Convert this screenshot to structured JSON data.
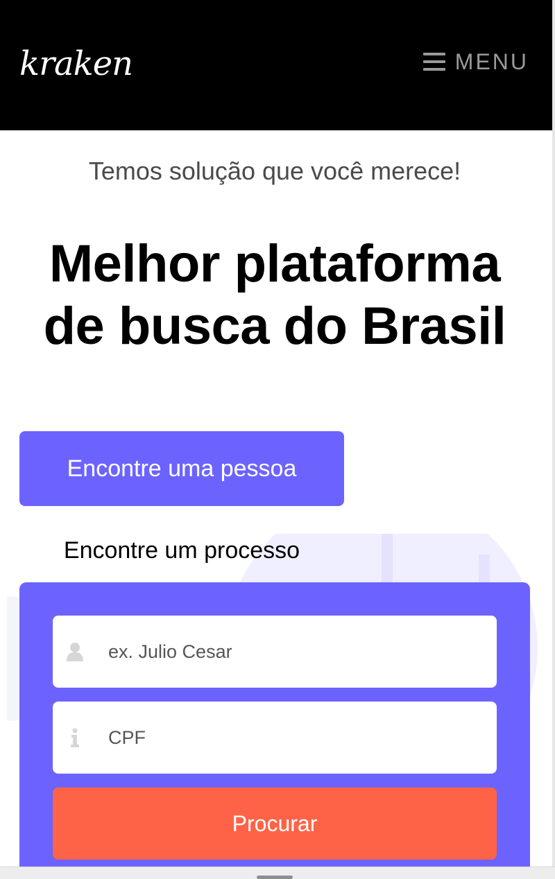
{
  "header": {
    "logo_text": "kraken",
    "menu_label": "MENU",
    "menu_icon": "hamburger-icon"
  },
  "hero": {
    "tagline": "Temos solução que você merece!",
    "headline_line1": "Melhor plataforma",
    "headline_line2": "de busca do Brasil"
  },
  "tabs": [
    {
      "label": "Encontre uma pessoa",
      "active": true
    },
    {
      "label": "Encontre um processo",
      "active": false
    }
  ],
  "search_form": {
    "name_placeholder": "ex. Julio Cesar",
    "name_icon": "user-icon",
    "cpf_placeholder": "CPF",
    "cpf_icon": "info-icon",
    "submit_label": "Procurar"
  },
  "colors": {
    "header_bg": "#000000",
    "accent": "#6c63ff",
    "button": "#ff6347",
    "menu_text": "#9a9a9a"
  }
}
